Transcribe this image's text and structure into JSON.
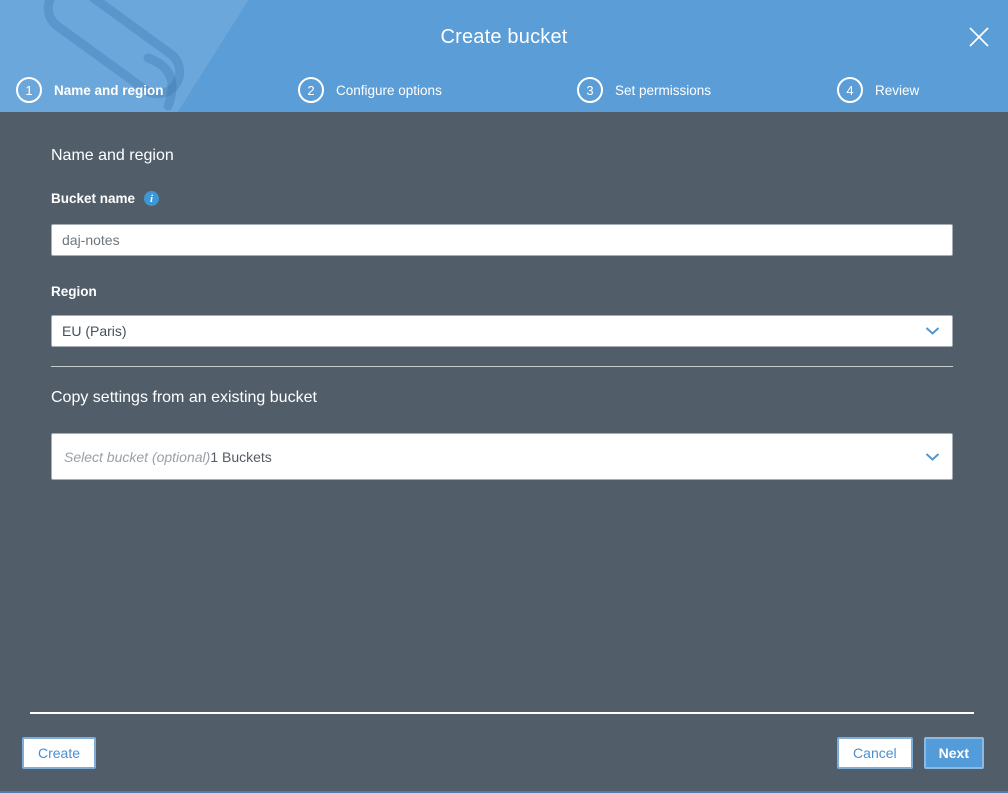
{
  "dialog": {
    "title": "Create bucket",
    "close_icon": "close-x"
  },
  "steps": [
    {
      "number": "1",
      "label": "Name and region",
      "state": "active"
    },
    {
      "number": "2",
      "label": "Configure options",
      "state": "upcoming"
    },
    {
      "number": "3",
      "label": "Set permissions",
      "state": "upcoming"
    },
    {
      "number": "4",
      "label": "Review",
      "state": "upcoming"
    }
  ],
  "form": {
    "section_heading": "Name and region",
    "bucket_name": {
      "label": "Bucket name",
      "value": "daj-notes",
      "info_icon_glyph": "i"
    },
    "region": {
      "label": "Region",
      "selected": "EU (Paris)"
    },
    "copy_settings": {
      "heading": "Copy settings from an existing bucket",
      "placeholder": "Select bucket (optional)",
      "buckets_count_text": "1 Buckets"
    }
  },
  "footer": {
    "create_label": "Create",
    "cancel_label": "Cancel",
    "next_label": "Next"
  },
  "colors": {
    "header_blue": "#5b9dd6",
    "body_slate": "#515e69",
    "primary_button_blue": "#539bd9",
    "button_text_blue": "#4a8fce",
    "info_icon_blue": "#3d96d5",
    "chevron_blue": "#5596cf",
    "input_border_gray": "#a5aeb5",
    "white": "#ffffff"
  }
}
